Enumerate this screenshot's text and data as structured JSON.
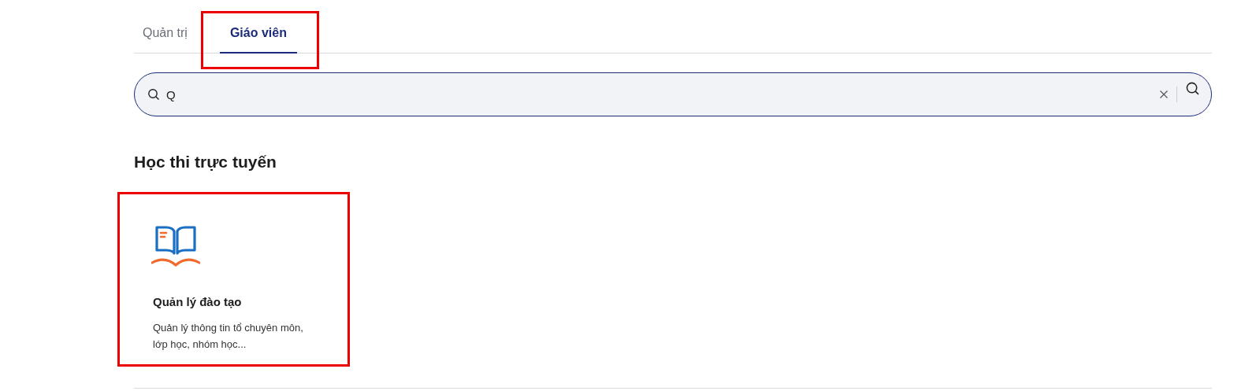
{
  "tabs": [
    {
      "label": "Quản trị",
      "selected": false,
      "highlighted": false
    },
    {
      "label": "Giáo viên",
      "selected": true,
      "highlighted": true
    }
  ],
  "search": {
    "value": "Q"
  },
  "section": {
    "title": "Học thi trực tuyến"
  },
  "cards": [
    {
      "title": "Quản lý đào tạo",
      "description": "Quản lý thông tin tổ chuyên môn, lớp học, nhóm học...",
      "highlighted": true
    }
  ]
}
